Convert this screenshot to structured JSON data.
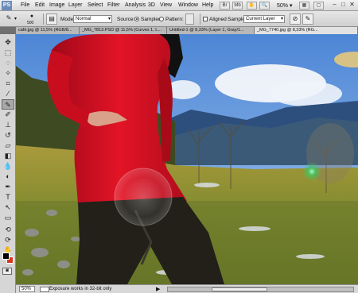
{
  "app": {
    "logo": "PS",
    "menu": [
      "File",
      "Edit",
      "Image",
      "Layer",
      "Select",
      "Filter",
      "Analysis",
      "3D",
      "View",
      "Window",
      "Help"
    ],
    "zoom": "50%"
  },
  "options": {
    "brush_size": "500",
    "mode_label": "Mode:",
    "mode_value": "Normal",
    "source_label": "Source:",
    "sampled_label": "Sampled",
    "pattern_label": "Pattern:",
    "aligned_label": "Aligned",
    "sample_label": "Sample:",
    "sample_value": "Current Layer"
  },
  "tabs": [
    "café.jpg @ 11,5% (RGB/8...",
    "_MG_7813.PSD @ 11,5% (Curves 1, L...",
    "Untitled-1 @ 8,33% (Layer 1, Gray/1...",
    "_MG_7740.jpg @ 8,33% (RG..."
  ],
  "status": {
    "zoom": "50%",
    "message": "Exposure works in 32-bit only",
    "arrow": "▶"
  },
  "colors": {
    "foreground": "#000000",
    "background": "#d8361c",
    "sky": "#6fa0e0",
    "dress": "#d0101e"
  },
  "icons": {
    "tool_preset": "healing-brush-icon",
    "window_minimize": "minimize-icon",
    "window_maximize": "maximize-icon",
    "window_close": "close-icon"
  }
}
